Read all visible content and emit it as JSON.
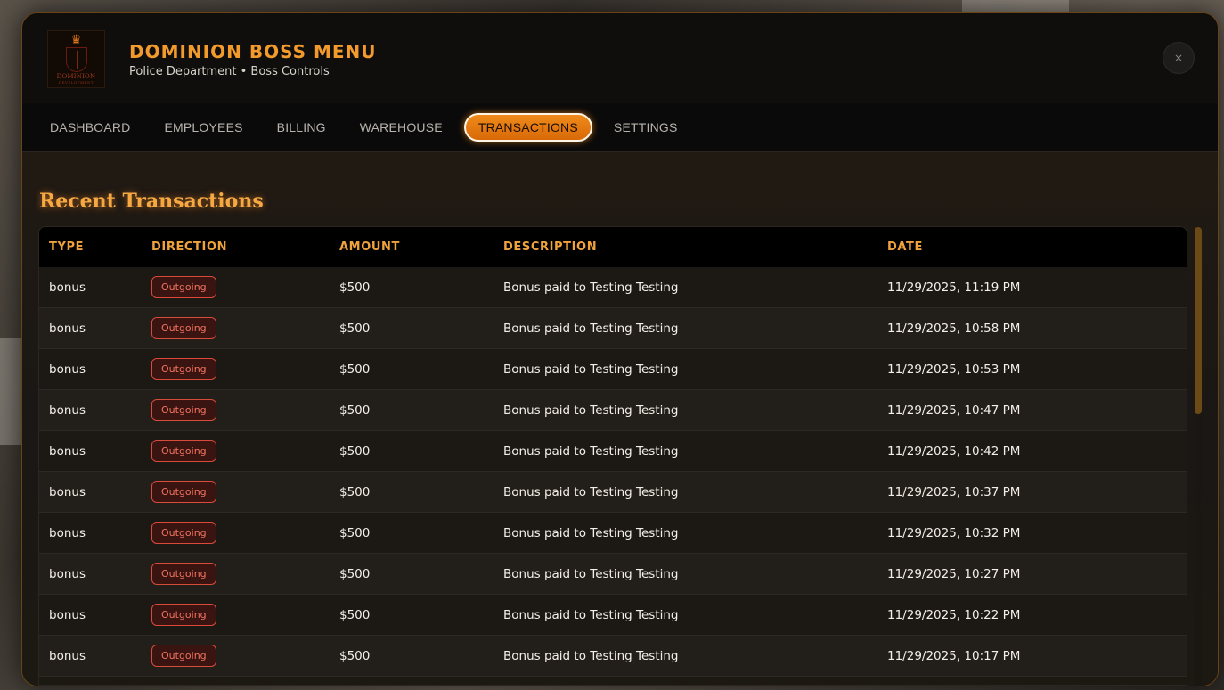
{
  "app": {
    "title": "DOMINION BOSS MENU",
    "subtitle": "Police Department • Boss Controls",
    "logo_text": "DOMINION",
    "logo_sub": "DEVELOPMENT",
    "close_label": "×"
  },
  "tabs": [
    {
      "label": "DASHBOARD",
      "active": false
    },
    {
      "label": "EMPLOYEES",
      "active": false
    },
    {
      "label": "BILLING",
      "active": false
    },
    {
      "label": "WAREHOUSE",
      "active": false
    },
    {
      "label": "TRANSACTIONS",
      "active": true
    },
    {
      "label": "SETTINGS",
      "active": false
    }
  ],
  "section": {
    "title": "Recent Transactions"
  },
  "table": {
    "columns": [
      "TYPE",
      "DIRECTION",
      "AMOUNT",
      "DESCRIPTION",
      "DATE"
    ],
    "rows": [
      {
        "type": "bonus",
        "direction": "Outgoing",
        "amount": "$500",
        "description": "Bonus paid to Testing Testing",
        "date": "11/29/2025, 11:19 PM"
      },
      {
        "type": "bonus",
        "direction": "Outgoing",
        "amount": "$500",
        "description": "Bonus paid to Testing Testing",
        "date": "11/29/2025, 10:58 PM"
      },
      {
        "type": "bonus",
        "direction": "Outgoing",
        "amount": "$500",
        "description": "Bonus paid to Testing Testing",
        "date": "11/29/2025, 10:53 PM"
      },
      {
        "type": "bonus",
        "direction": "Outgoing",
        "amount": "$500",
        "description": "Bonus paid to Testing Testing",
        "date": "11/29/2025, 10:47 PM"
      },
      {
        "type": "bonus",
        "direction": "Outgoing",
        "amount": "$500",
        "description": "Bonus paid to Testing Testing",
        "date": "11/29/2025, 10:42 PM"
      },
      {
        "type": "bonus",
        "direction": "Outgoing",
        "amount": "$500",
        "description": "Bonus paid to Testing Testing",
        "date": "11/29/2025, 10:37 PM"
      },
      {
        "type": "bonus",
        "direction": "Outgoing",
        "amount": "$500",
        "description": "Bonus paid to Testing Testing",
        "date": "11/29/2025, 10:32 PM"
      },
      {
        "type": "bonus",
        "direction": "Outgoing",
        "amount": "$500",
        "description": "Bonus paid to Testing Testing",
        "date": "11/29/2025, 10:27 PM"
      },
      {
        "type": "bonus",
        "direction": "Outgoing",
        "amount": "$500",
        "description": "Bonus paid to Testing Testing",
        "date": "11/29/2025, 10:22 PM"
      },
      {
        "type": "bonus",
        "direction": "Outgoing",
        "amount": "$500",
        "description": "Bonus paid to Testing Testing",
        "date": "11/29/2025, 10:17 PM"
      }
    ]
  },
  "colors": {
    "accent": "#f39a2c",
    "badge_outgoing": "#d84a3a",
    "background": "#17140f"
  },
  "icons": {
    "close": "close-icon",
    "logo": "crown-shield-icon"
  }
}
